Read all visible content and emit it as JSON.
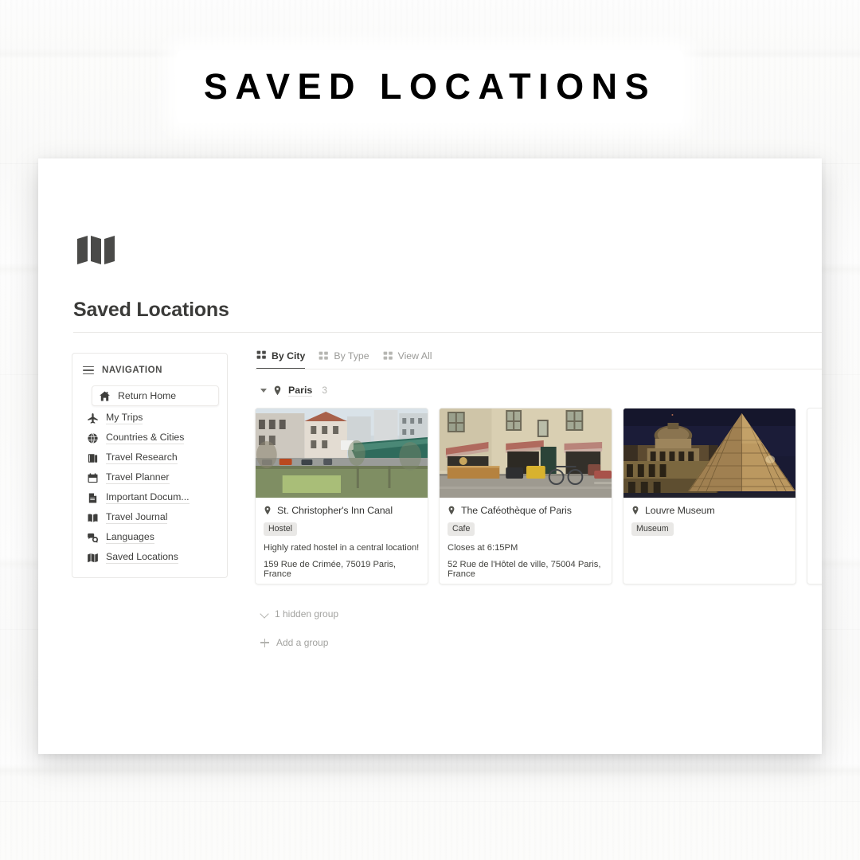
{
  "banner": {
    "title": "SAVED LOCATIONS"
  },
  "page": {
    "icon": "folded-map-icon",
    "title": "Saved Locations"
  },
  "sidebar": {
    "heading": "NAVIGATION",
    "menu_icon": "hamburger-icon",
    "items": [
      {
        "label": "Return Home",
        "icon": "home-icon",
        "active": true
      },
      {
        "label": "My Trips",
        "icon": "airplane-icon",
        "active": false
      },
      {
        "label": "Countries & Cities",
        "icon": "globe-icon",
        "active": false
      },
      {
        "label": "Travel Research",
        "icon": "books-icon",
        "active": false
      },
      {
        "label": "Travel Planner",
        "icon": "calendar-icon",
        "active": false
      },
      {
        "label": "Important Docum...",
        "icon": "document-icon",
        "active": false
      },
      {
        "label": "Travel Journal",
        "icon": "open-book-icon",
        "active": false
      },
      {
        "label": "Languages",
        "icon": "speech-bubbles-icon",
        "active": false
      },
      {
        "label": "Saved Locations",
        "icon": "folded-map-icon",
        "active": false
      }
    ]
  },
  "tabs": [
    {
      "label": "By City",
      "icon": "gallery-grid-icon",
      "active": true
    },
    {
      "label": "By Type",
      "icon": "gallery-grid-icon",
      "active": false
    },
    {
      "label": "View All",
      "icon": "gallery-grid-icon",
      "active": false
    }
  ],
  "group": {
    "name": "Paris",
    "count": "3",
    "pin_icon": "map-pin-icon",
    "toggle_icon": "caret-down-icon"
  },
  "cards": [
    {
      "title": "St. Christopher's Inn Canal",
      "pin_icon": "map-pin-icon",
      "tag": "Hostel",
      "note": "Highly rated hostel in a central location!",
      "address": "159 Rue de Crimée, 75019 Paris, France",
      "photo": "canal-waterfront-buildings-photo"
    },
    {
      "title": "The Caféothèque of Paris",
      "pin_icon": "map-pin-icon",
      "tag": "Cafe",
      "note": "Closes at 6:15PM",
      "address": "52 Rue de l'Hôtel de ville, 75004 Paris, France",
      "photo": "paris-cafe-storefront-photo"
    },
    {
      "title": "Louvre Museum",
      "pin_icon": "map-pin-icon",
      "tag": "Museum",
      "note": "",
      "address": "",
      "photo": "louvre-pyramid-night-photo"
    }
  ],
  "footer_actions": [
    {
      "label": "1 hidden group",
      "icon": "chevron-down-icon"
    },
    {
      "label": "Add a group",
      "icon": "plus-icon"
    }
  ],
  "colors": {
    "text_dark": "#373735",
    "text_muted": "#a3a3a0",
    "tag_bg": "#e9e8e6",
    "border": "#ececea",
    "icon_dark": "#4a4a48"
  }
}
